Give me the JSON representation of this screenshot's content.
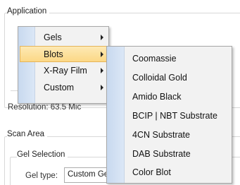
{
  "dialog": {
    "application_group": "Application",
    "resolution_text": "Resolution: 63.5 Mic",
    "scan_area_group": "Scan Area",
    "gel_selection_group": "Gel Selection",
    "gel_type_label": "Gel type:",
    "gel_type_value": "Custom Gel"
  },
  "main_menu": {
    "items": [
      {
        "label": "Gels",
        "has_submenu": true
      },
      {
        "label": "Blots",
        "has_submenu": true,
        "highlighted": true
      },
      {
        "label": "X-Ray Film",
        "has_submenu": true
      },
      {
        "label": "Custom",
        "has_submenu": true
      }
    ]
  },
  "blots_submenu": {
    "items": [
      {
        "label": "Coomassie"
      },
      {
        "label": "Colloidal Gold"
      },
      {
        "label": "Amido Black"
      },
      {
        "label": "BCIP | NBT Substrate"
      },
      {
        "label": "4CN Substrate"
      },
      {
        "label": "DAB Substrate"
      },
      {
        "label": "Color Blot"
      }
    ]
  },
  "colors": {
    "highlight_fill": "#fcd886",
    "highlight_border": "#e5b45a",
    "menu_background": "#f2f2f2",
    "gutter": "#c8d9ef"
  }
}
